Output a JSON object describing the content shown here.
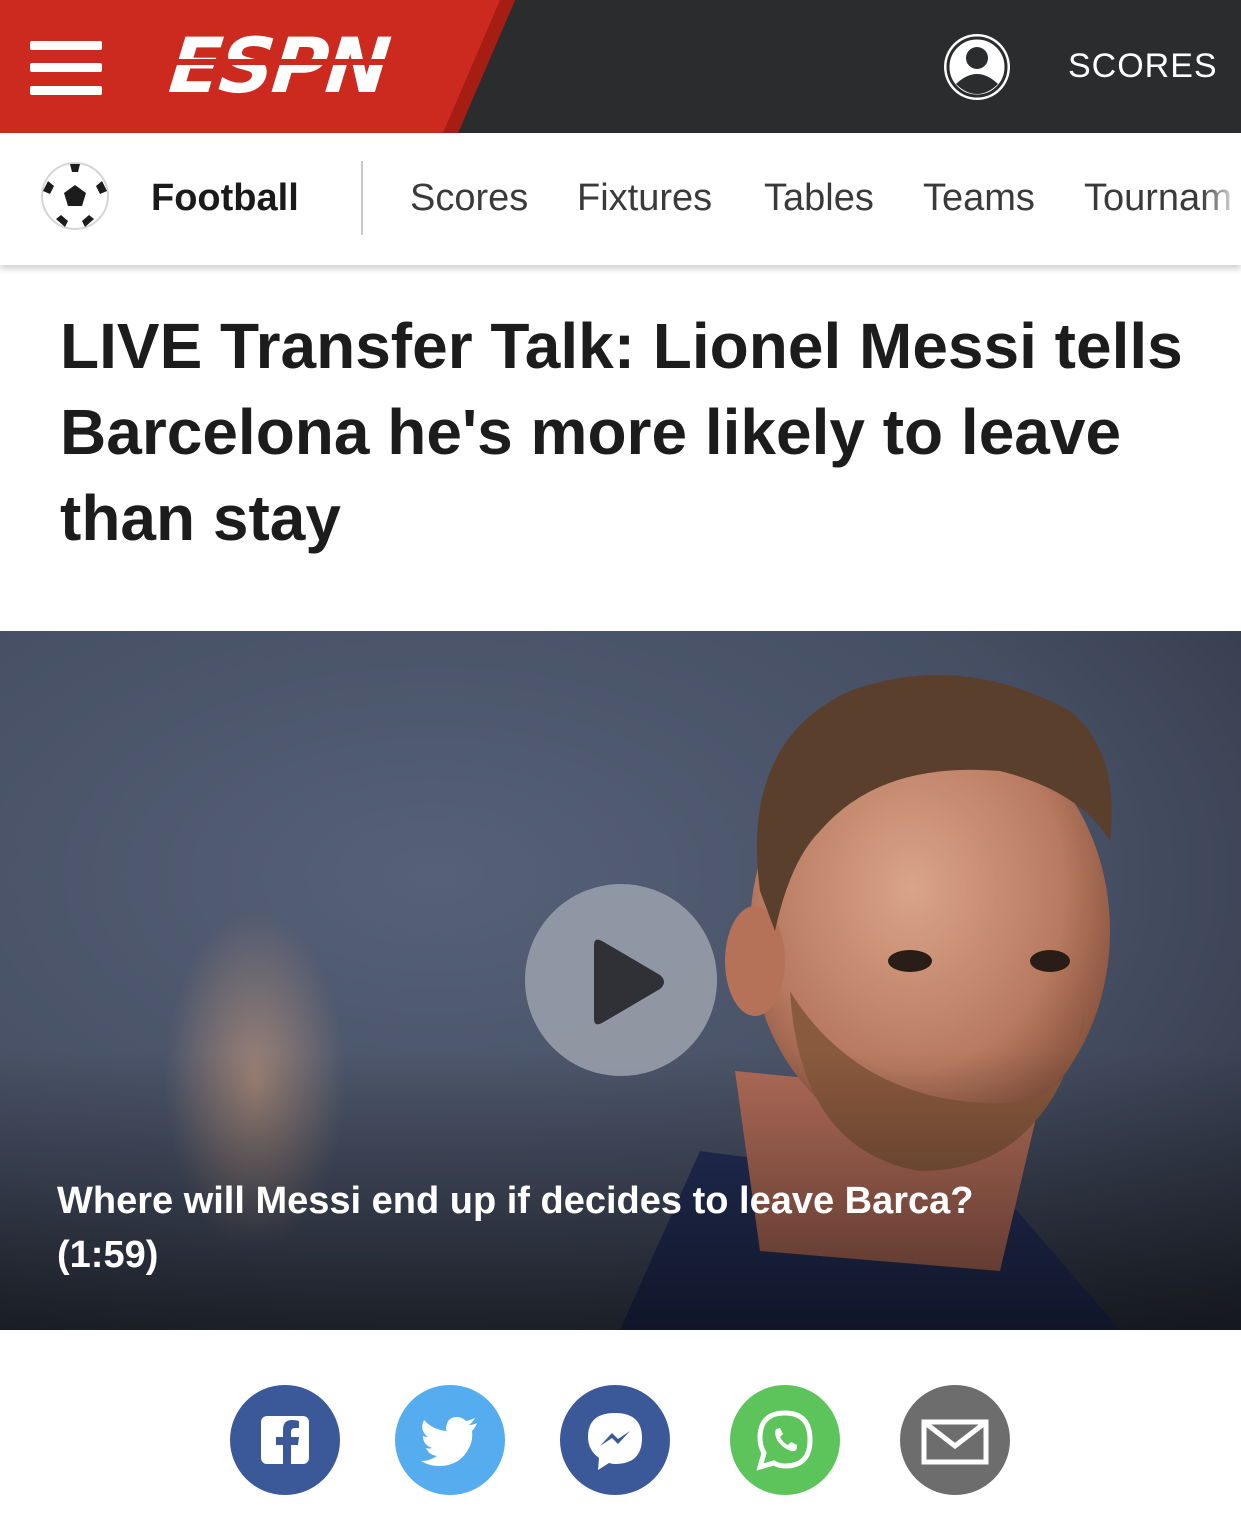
{
  "header": {
    "brand": "ESPN",
    "scores_label": "SCORES",
    "menu_icon": "hamburger-menu-icon",
    "profile_icon": "user-profile-icon",
    "colors": {
      "brand_red": "#cc2a1f",
      "bar_dark": "#2b2c2d"
    }
  },
  "subnav": {
    "section": "Football",
    "section_icon": "soccer-ball-icon",
    "items": [
      {
        "label": "Scores"
      },
      {
        "label": "Fixtures"
      },
      {
        "label": "Tables"
      },
      {
        "label": "Teams"
      },
      {
        "label": "Tournam"
      }
    ]
  },
  "article": {
    "headline": "LIVE Transfer Talk: Lionel Messi tells Barcelona he's more likely to leave than stay"
  },
  "video": {
    "caption": "Where will Messi end up if decides to leave Barca?",
    "duration": "(1:59)",
    "play_icon": "play-icon"
  },
  "share": {
    "buttons": [
      {
        "icon": "facebook-icon",
        "color": "#3b5998"
      },
      {
        "icon": "twitter-icon",
        "color": "#55acee"
      },
      {
        "icon": "messenger-icon",
        "color": "#3b5998"
      },
      {
        "icon": "whatsapp-icon",
        "color": "#5cc45a"
      },
      {
        "icon": "email-icon",
        "color": "#6d6d6d"
      }
    ]
  }
}
